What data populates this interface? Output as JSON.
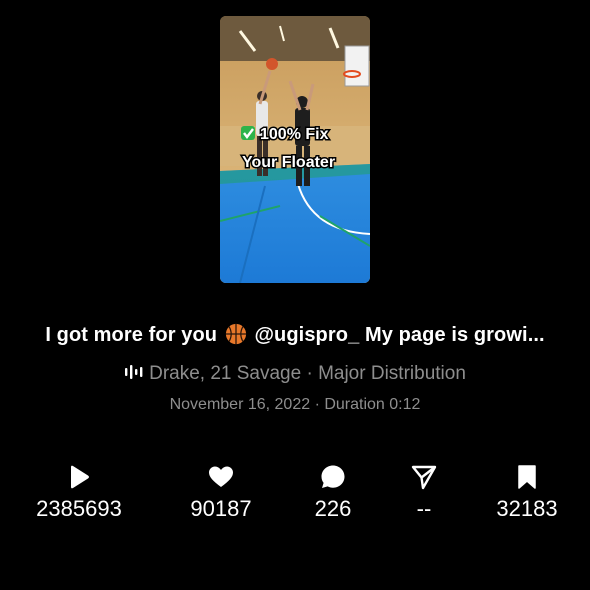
{
  "thumbnail": {
    "overlay_line1": "✅ 100% Fix",
    "overlay_line2": "Your Floater"
  },
  "caption": {
    "before_emoji": "I got more for you ",
    "emoji": "basketball-emoji",
    "after_emoji": " @ugispro_ My page is growi..."
  },
  "music": {
    "icon": "waveform-icon",
    "text": "Drake, 21 Savage · Major Distribution"
  },
  "meta": {
    "text": "November 16, 2022 · Duration 0:12"
  },
  "stats": {
    "plays": "2385693",
    "likes": "90187",
    "comments": "226",
    "shares": "--",
    "saves": "32183"
  },
  "colors": {
    "background": "#000000",
    "primary_text": "#ffffff",
    "secondary_text": "#8e8e8e"
  }
}
